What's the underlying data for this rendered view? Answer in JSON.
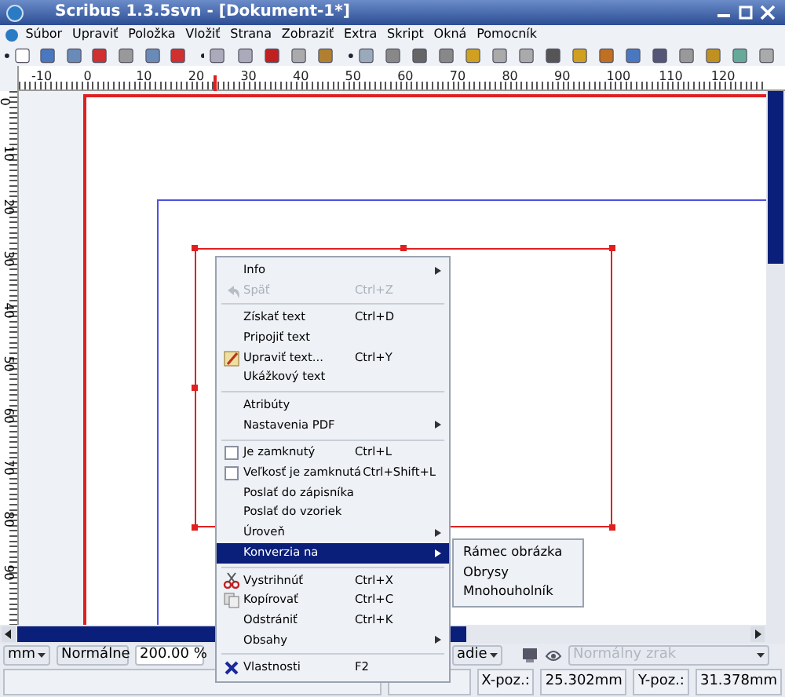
{
  "window": {
    "title": "Scribus 1.3.5svn - [Dokument-1*]"
  },
  "menubar": [
    {
      "label": "Súbor"
    },
    {
      "label": "Upraviť"
    },
    {
      "label": "Položka"
    },
    {
      "label": "Vložiť"
    },
    {
      "label": "Strana"
    },
    {
      "label": "Zobraziť"
    },
    {
      "label": "Extra"
    },
    {
      "label": "Skript"
    },
    {
      "label": "Okná"
    },
    {
      "label": "Pomocník"
    }
  ],
  "ruler": {
    "top_labels": [
      "-10",
      "0",
      "10",
      "20",
      "30",
      "40",
      "50",
      "60",
      "70",
      "80",
      "90",
      "100",
      "110",
      "120"
    ],
    "left_labels": [
      "0",
      "10",
      "20",
      "30",
      "40",
      "50",
      "60",
      "70",
      "80",
      "90"
    ]
  },
  "context_menu": {
    "items": [
      {
        "kind": "item",
        "label": "Info",
        "submenu": true,
        "disabled": false,
        "selected": false
      },
      {
        "kind": "item",
        "label": "Späť",
        "shortcut": "Ctrl+Z",
        "submenu": false,
        "disabled": true,
        "selected": false
      },
      {
        "kind": "separator"
      },
      {
        "kind": "item",
        "label": "Získať text",
        "shortcut": "Ctrl+D",
        "submenu": false,
        "disabled": false,
        "selected": false
      },
      {
        "kind": "item",
        "label": "Pripojiť text",
        "submenu": false,
        "disabled": false,
        "selected": false
      },
      {
        "kind": "item",
        "label": "Upraviť text...",
        "shortcut": "Ctrl+Y",
        "submenu": false,
        "disabled": false,
        "selected": false
      },
      {
        "kind": "item",
        "label": "Ukážkový text",
        "submenu": false,
        "disabled": false,
        "selected": false
      },
      {
        "kind": "separator"
      },
      {
        "kind": "item",
        "label": "Atribúty",
        "submenu": false,
        "disabled": false,
        "selected": false
      },
      {
        "kind": "item",
        "label": "Nastavenia PDF",
        "submenu": true,
        "disabled": false,
        "selected": false
      },
      {
        "kind": "separator"
      },
      {
        "kind": "checkbox",
        "label": "Je zamknutý",
        "shortcut": "Ctrl+L",
        "checked": false,
        "submenu": false,
        "disabled": false,
        "selected": false
      },
      {
        "kind": "checkbox",
        "label": "Veľkosť je zamknutá",
        "shortcut": "Ctrl+Shift+L",
        "checked": false,
        "submenu": false,
        "disabled": false,
        "selected": false
      },
      {
        "kind": "item",
        "label": "Poslať do zápisníka",
        "submenu": false,
        "disabled": false,
        "selected": false
      },
      {
        "kind": "item",
        "label": "Poslať do vzoriek",
        "submenu": false,
        "disabled": false,
        "selected": false
      },
      {
        "kind": "item",
        "label": "Úroveň",
        "submenu": true,
        "disabled": false,
        "selected": false
      },
      {
        "kind": "item",
        "label": "Konverzia na",
        "submenu": true,
        "disabled": false,
        "selected": true
      },
      {
        "kind": "separator"
      },
      {
        "kind": "item",
        "label": "Vystrihnúť",
        "shortcut": "Ctrl+X",
        "submenu": false,
        "disabled": false,
        "selected": false
      },
      {
        "kind": "item",
        "label": "Kopírovať",
        "shortcut": "Ctrl+C",
        "submenu": false,
        "disabled": false,
        "selected": false
      },
      {
        "kind": "item",
        "label": "Odstrániť",
        "shortcut": "Ctrl+K",
        "submenu": false,
        "disabled": false,
        "selected": false
      },
      {
        "kind": "item",
        "label": "Obsahy",
        "submenu": true,
        "disabled": false,
        "selected": false
      },
      {
        "kind": "separator"
      },
      {
        "kind": "item",
        "label": "Vlastnosti",
        "shortcut": "F2",
        "submenu": false,
        "disabled": false,
        "selected": false
      }
    ]
  },
  "submenu": {
    "items": [
      {
        "label": "Rámec obrázka"
      },
      {
        "label": "Obrysy"
      },
      {
        "label": "Mnohouholník"
      }
    ]
  },
  "status_bar": {
    "unit": "mm",
    "mode": "Normálne",
    "zoom": "200.00 %",
    "layer": "adie",
    "vision": "Normálny zrak",
    "vision_disabled": true,
    "x_label": "X-poz.:",
    "x_value": "25.302mm",
    "y_label": "Y-poz.:",
    "y_value": "31.378mm"
  }
}
